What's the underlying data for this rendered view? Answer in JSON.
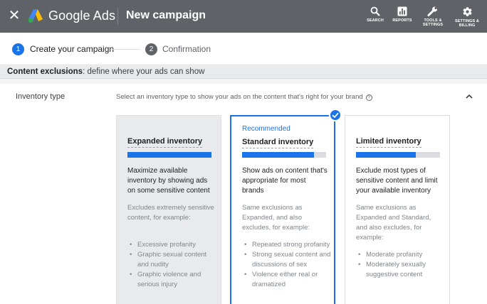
{
  "header": {
    "close_glyph": "✕",
    "brand": "Google Ads",
    "page_title": "New campaign",
    "nav": [
      {
        "label_line1": "SEARCH",
        "label_line2": ""
      },
      {
        "label_line1": "REPORTS",
        "label_line2": ""
      },
      {
        "label_line1": "TOOLS &",
        "label_line2": "SETTINGS"
      },
      {
        "label_line1": "SETTINGS &",
        "label_line2": "BILLING"
      }
    ]
  },
  "stepper": {
    "steps": [
      {
        "number": "1",
        "label": "Create your campaign",
        "active": true
      },
      {
        "number": "2",
        "label": "Confirmation",
        "active": false
      }
    ]
  },
  "section": {
    "title": "Content exclusions",
    "subtitle": ": define where your ads can show"
  },
  "inventory": {
    "label": "Inventory type",
    "description": "Select an inventory type to show your ads on the content that's right for your brand",
    "help_glyph": "?",
    "cards": [
      {
        "recommended": "",
        "title": "Expanded inventory",
        "level": 1.0,
        "lead": "Maximize available inventory by showing ads on some sensitive content",
        "sub": "Excludes extremely sensitive content, for example:",
        "items": [
          "Excessive profanity",
          "Graphic sexual content and nudity",
          "Graphic violence and serious injury"
        ]
      },
      {
        "recommended": "Recommended",
        "title": "Standard inventory",
        "level": 0.86,
        "lead": "Show ads on content that's appropriate for most brands",
        "sub": "Same exclusions as Expanded, and also excludes, for example:",
        "items": [
          "Repeated strong profanity",
          "Strong sexual content and discussions of sex",
          "Violence either real or dramatized"
        ]
      },
      {
        "recommended": "",
        "title": "Limited inventory",
        "level": 0.71,
        "lead": "Exclude most types of sensitive content and limit your available inventory",
        "sub": "Same exclusions as Expanded and Standard, and also excludes, for example:",
        "items": [
          "Moderate profanity",
          "Moderately sexually suggestive content"
        ]
      }
    ]
  },
  "colors": {
    "topbar": "#5f6368",
    "accent": "#1a73e8",
    "step_inactive": "#5f6368"
  }
}
